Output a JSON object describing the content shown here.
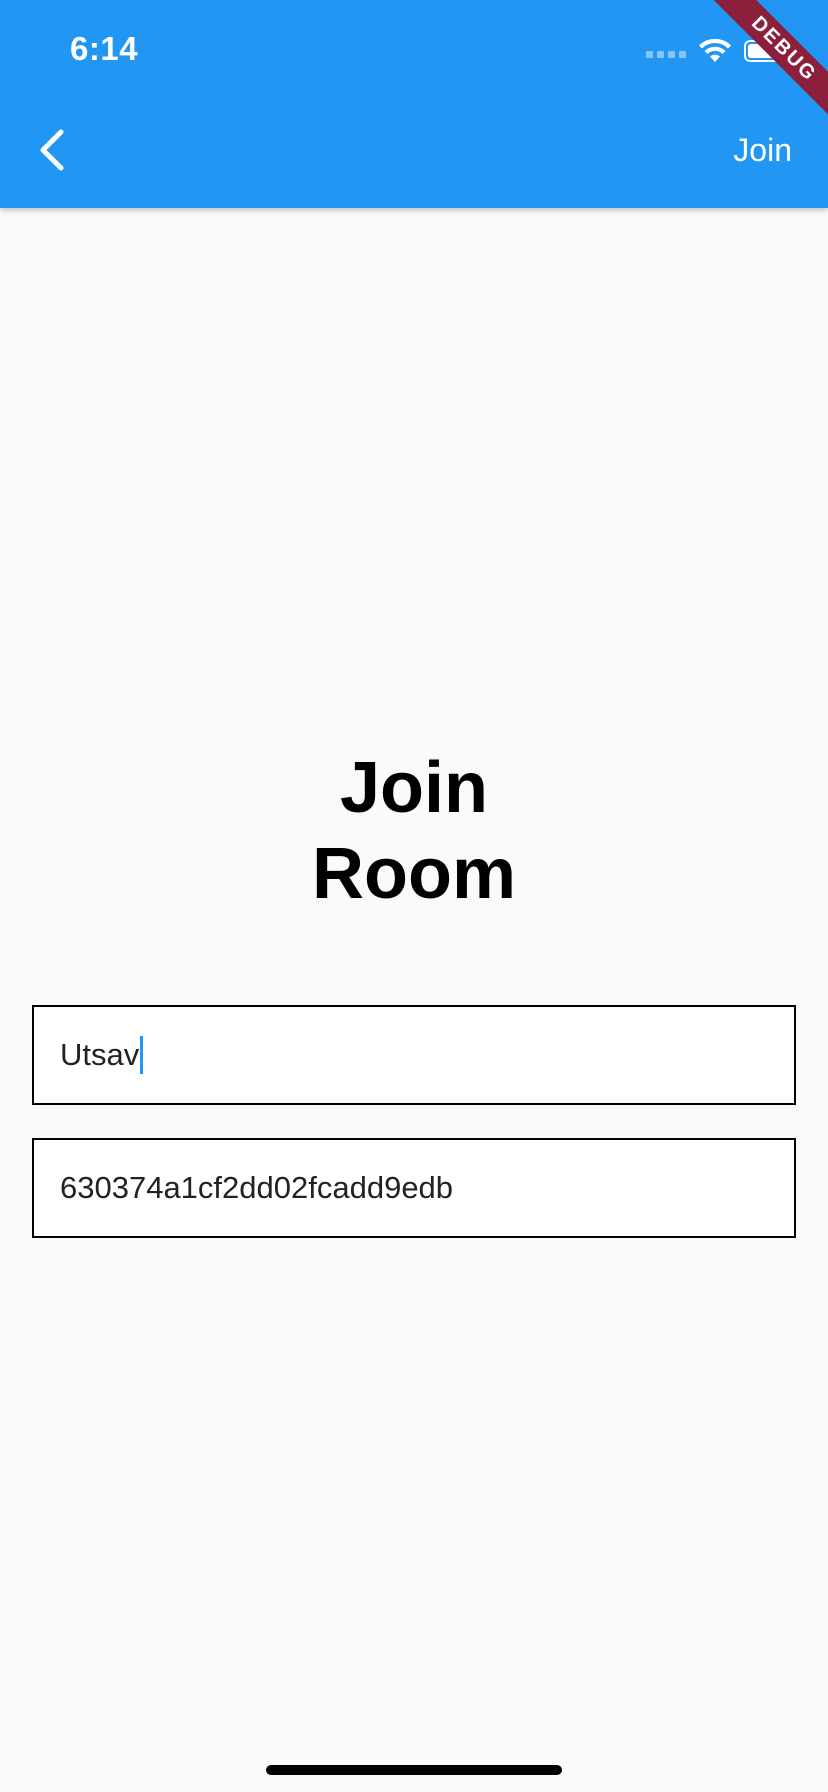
{
  "status_bar": {
    "time": "6:14"
  },
  "app_bar": {
    "back_icon": "chevron-left-icon",
    "action_label": "Join",
    "background_color": "#2196f3"
  },
  "debug_banner": {
    "label": "DEBUG",
    "color": "#8b1f3c"
  },
  "main": {
    "title_line1": "Join",
    "title_line2": "Room",
    "name_input": {
      "value": "Utsav"
    },
    "room_input": {
      "value": "630374a1cf2dd02fcadd9edb"
    }
  }
}
